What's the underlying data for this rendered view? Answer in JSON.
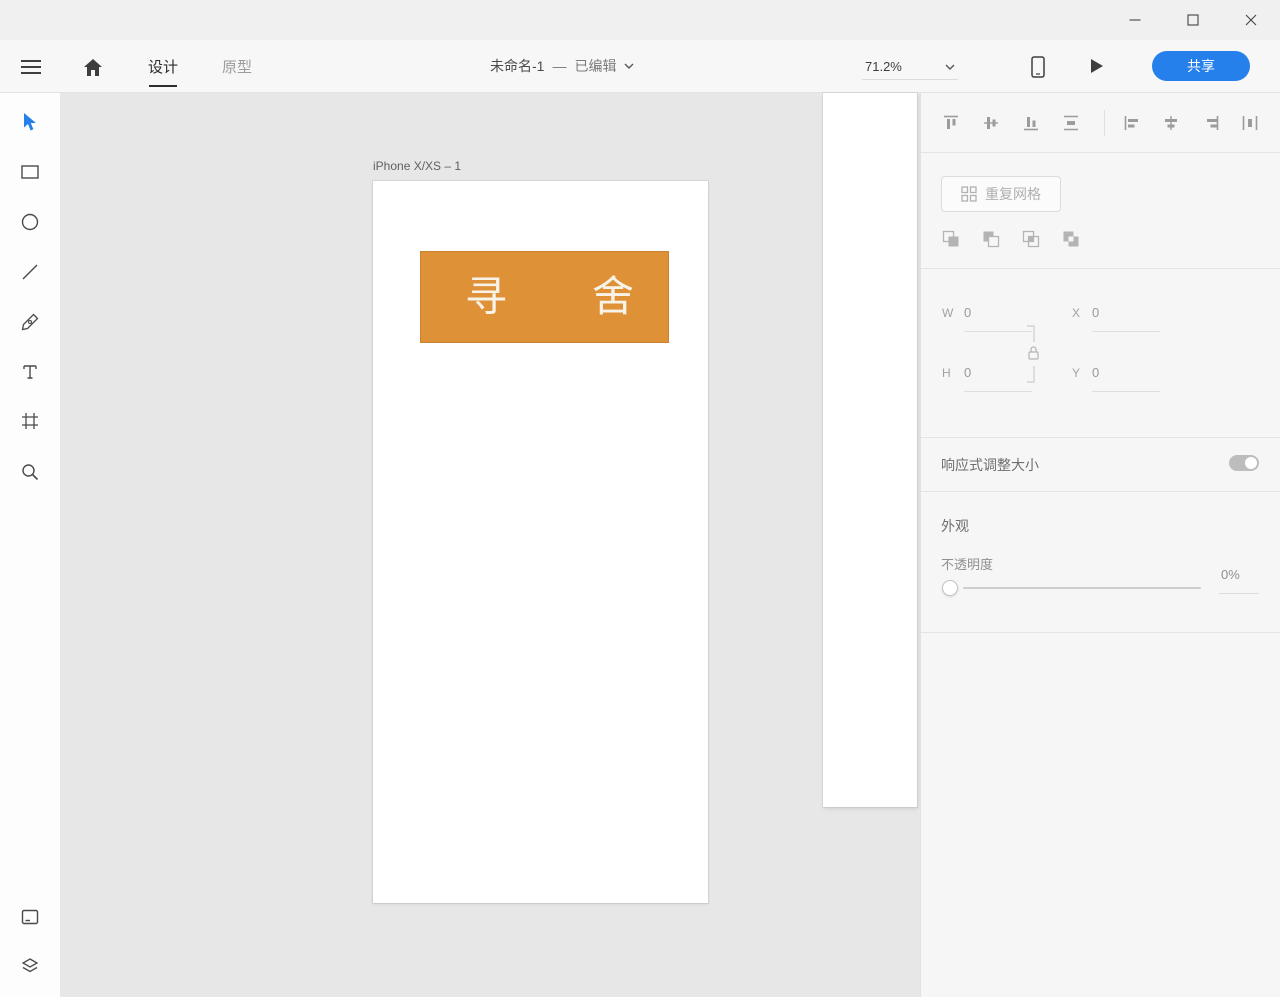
{
  "window": {
    "controls": {
      "minimize": "minimize",
      "maximize": "maximize",
      "close": "close"
    }
  },
  "toolbar": {
    "tabs": [
      {
        "label": "设计",
        "active": true
      },
      {
        "label": "原型",
        "active": false
      }
    ],
    "document": {
      "title": "未命名-1",
      "separator": "—",
      "status": "已编辑"
    },
    "zoom_value": "71.2%",
    "share_label": "共享"
  },
  "canvas": {
    "artboard_label": "iPhone X/XS – 1",
    "shape": {
      "fill": "#DF9137",
      "char_left": "寻",
      "char_right": "舍"
    }
  },
  "inspector": {
    "repeat_grid_label": "重复网格",
    "transform": {
      "w_label": "W",
      "w_value": "0",
      "h_label": "H",
      "h_value": "0",
      "x_label": "X",
      "x_value": "0",
      "y_label": "Y",
      "y_value": "0"
    },
    "responsive_resize_label": "响应式调整大小",
    "appearance": {
      "section_label": "外观",
      "opacity_label": "不透明度",
      "opacity_value": "0%"
    }
  },
  "colors": {
    "accent_blue": "#2680EB",
    "shape_orange": "#DF9137"
  }
}
